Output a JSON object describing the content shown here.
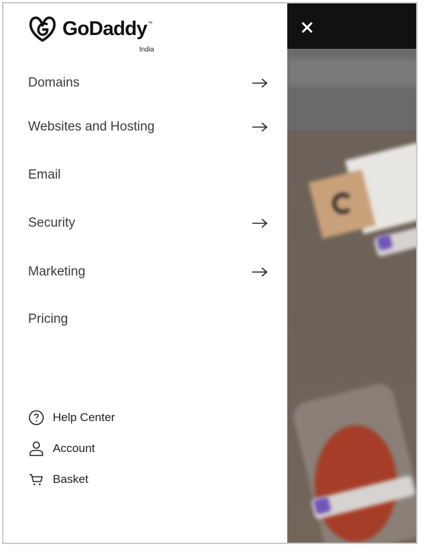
{
  "brand": {
    "name": "GoDaddy",
    "tm": "™",
    "region": "India"
  },
  "nav": {
    "items": [
      {
        "label": "Domains",
        "has_submenu": true
      },
      {
        "label": "Websites and Hosting",
        "has_submenu": true
      },
      {
        "label": "Email",
        "has_submenu": false
      },
      {
        "label": "Security",
        "has_submenu": true
      },
      {
        "label": "Marketing",
        "has_submenu": true
      },
      {
        "label": "Pricing",
        "has_submenu": false
      }
    ]
  },
  "utility": {
    "help": {
      "label": "Help Center",
      "icon": "help-circle-icon"
    },
    "account": {
      "label": "Account",
      "icon": "user-icon"
    },
    "basket": {
      "label": "Basket",
      "icon": "cart-icon"
    }
  },
  "header": {
    "close_icon": "close-icon"
  },
  "colors": {
    "topbar": "#111111",
    "text": "#3a3a3a",
    "backdrop": "#6d6259"
  }
}
